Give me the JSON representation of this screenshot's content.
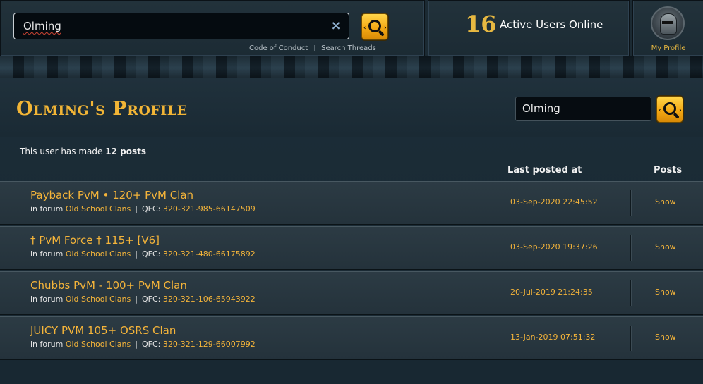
{
  "header": {
    "search_value": "Olming",
    "clear_symbol": "×",
    "links": [
      "Code of Conduct",
      "Search Threads"
    ],
    "active_users_count": "16",
    "active_users_label": "Active Users Online",
    "profile_label": "My Profile"
  },
  "profile": {
    "title": "Olming's Profile",
    "search_value": "Olming",
    "summary_prefix": "This user has made",
    "summary_count": "12 posts"
  },
  "table": {
    "col_last_posted": "Last posted at",
    "col_posts": "Posts"
  },
  "threads": [
    {
      "title": "Payback PvM • 120+ PvM Clan",
      "in_forum": "in forum",
      "forum": "Old School Clans",
      "qfc_label": "QFC:",
      "qfc": "320-321-985-66147509",
      "last_posted": "03-Sep-2020 22:45:52",
      "action": "Show"
    },
    {
      "title": "† PvM Force † 115+ [V6]",
      "in_forum": "in forum",
      "forum": "Old School Clans",
      "qfc_label": "QFC:",
      "qfc": "320-321-480-66175892",
      "last_posted": "03-Sep-2020 19:37:26",
      "action": "Show"
    },
    {
      "title": "Chubbs PvM - 100+ PvM Clan",
      "in_forum": "in forum",
      "forum": "Old School Clans",
      "qfc_label": "QFC:",
      "qfc": "320-321-106-65943922",
      "last_posted": "20-Jul-2019 21:24:35",
      "action": "Show"
    },
    {
      "title": "JUICY PVM 105+ OSRS Clan",
      "in_forum": "in forum",
      "forum": "Old School Clans",
      "qfc_label": "QFC:",
      "qfc": "320-321-129-66007992",
      "last_posted": "13-Jan-2019 07:51:32",
      "action": "Show"
    }
  ],
  "colors": {
    "gold": "#f4b43a",
    "background": "#15222b",
    "button": "#f4a914"
  }
}
